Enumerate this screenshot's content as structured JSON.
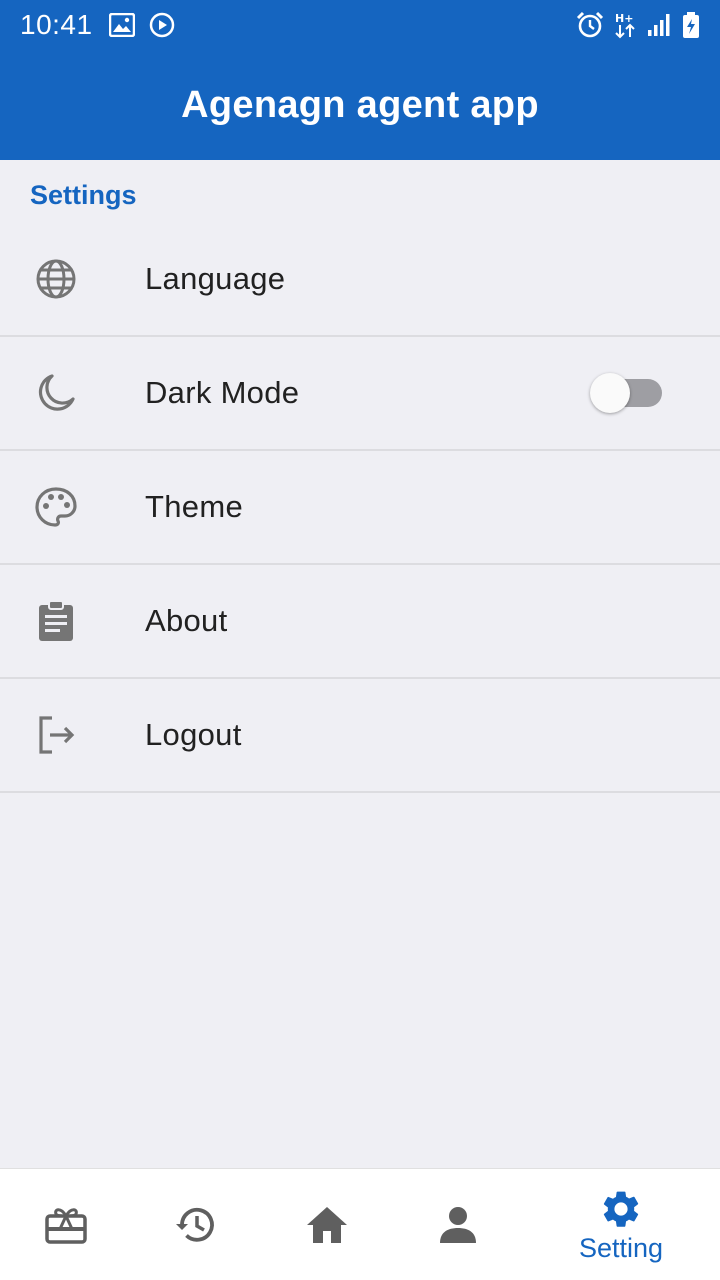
{
  "status_bar": {
    "time": "10:41",
    "icons_left": [
      "image-icon",
      "play-circle-icon"
    ],
    "icons_right": [
      "alarm-icon",
      "data-arrows-icon",
      "signal-icon",
      "battery-charging-icon"
    ]
  },
  "app_bar": {
    "title": "Agenagn agent app"
  },
  "settings": {
    "header": "Settings",
    "items": [
      {
        "label": "Language",
        "icon": "globe-icon"
      },
      {
        "label": "Dark Mode",
        "icon": "moon-icon",
        "toggle_on": false
      },
      {
        "label": "Theme",
        "icon": "palette-icon"
      },
      {
        "label": "About",
        "icon": "clipboard-icon"
      },
      {
        "label": "Logout",
        "icon": "logout-icon"
      }
    ]
  },
  "bottom_nav": {
    "items": [
      {
        "icon": "gift-card-icon"
      },
      {
        "icon": "history-icon"
      },
      {
        "icon": "home-icon"
      },
      {
        "icon": "person-icon"
      },
      {
        "icon": "gear-icon",
        "label": "Setting",
        "active": true
      }
    ]
  },
  "colors": {
    "primary": "#1565c0",
    "background": "#efeff4",
    "icon_gray": "#757575",
    "nav_icon": "#5f5f5f"
  }
}
